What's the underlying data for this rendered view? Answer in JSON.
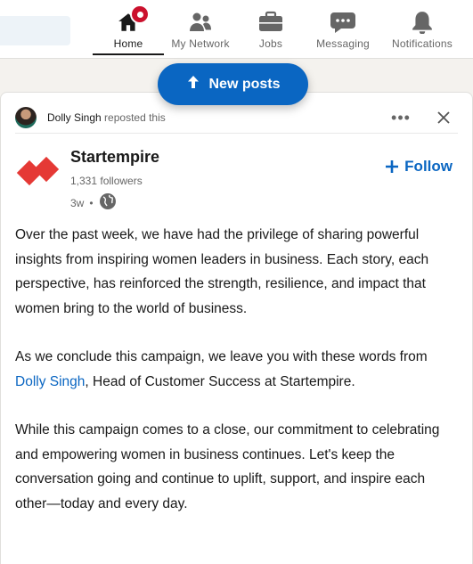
{
  "nav": {
    "items": [
      {
        "label": "Home",
        "icon": "home-icon",
        "active": true
      },
      {
        "label": "My Network",
        "icon": "people-icon"
      },
      {
        "label": "Jobs",
        "icon": "briefcase-icon"
      },
      {
        "label": "Messaging",
        "icon": "chat-icon"
      },
      {
        "label": "Notifications",
        "icon": "bell-icon"
      }
    ]
  },
  "new_posts": {
    "label": "New posts",
    "icon": "arrow-up-icon"
  },
  "post": {
    "repost": {
      "name": "Dolly Singh",
      "action": "reposted this"
    },
    "author": {
      "name": "Startempire",
      "followers": "1,331 followers",
      "age": "3w",
      "visibility_icon": "globe-icon"
    },
    "follow_label": "Follow",
    "body": {
      "p1": "Over the past week, we have had the privilege of sharing powerful insights from inspiring women leaders in business. Each story, each perspective, has reinforced the strength, resilience, and impact that women bring to the world of business.",
      "p2_before": "As we conclude this campaign, we leave you with these words from ",
      "p2_mention": "Dolly Singh",
      "p2_after": ", Head of Customer Success at Startempire.",
      "p3": "While this campaign comes to a close, our commitment to celebrating and empowering women in business continues. Let's keep the conversation going and continue to uplift, support, and inspire each other—today and every day."
    }
  },
  "colors": {
    "brand_blue": "#0a66c2",
    "notification_red": "#cb112d",
    "logo_red": "#e53935"
  }
}
